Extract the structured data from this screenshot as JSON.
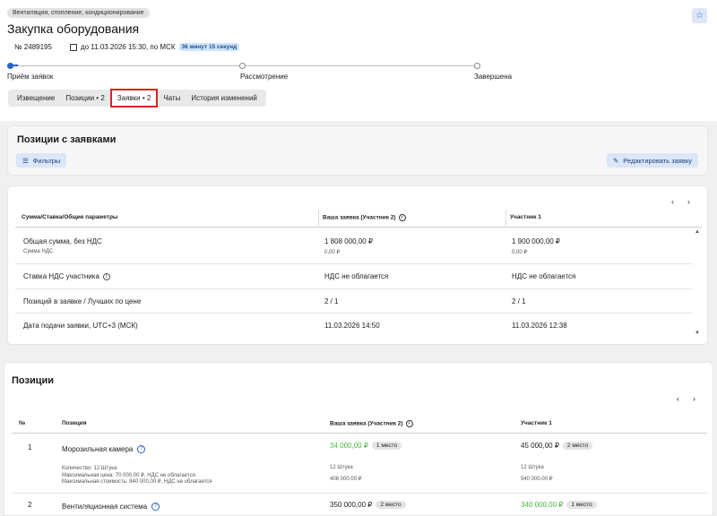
{
  "header": {
    "category": "Вентиляция, отопление, кондиционирование",
    "title": "Закупка оборудования",
    "number": "№ 2489195",
    "deadline": "до 11.03.2026 15:30, по МСК",
    "timer": "36 минут 15 секунд"
  },
  "stages": [
    {
      "label": "Приём заявок",
      "active": true
    },
    {
      "label": "Рассмотрение",
      "active": false
    },
    {
      "label": "Завершена",
      "active": false
    }
  ],
  "tabs": [
    {
      "label": "Извещение"
    },
    {
      "label": "Позиции • 2"
    },
    {
      "label": "Заявки • 2"
    },
    {
      "label": "Чаты"
    },
    {
      "label": "История изменений"
    }
  ],
  "bids_card": {
    "title": "Позиции с заявками",
    "filter_label": "Фильтры",
    "edit_label": "Редактировать заявку"
  },
  "summary_table": {
    "columns": [
      "Сумма/Ставка/Общие параметры",
      "Ваша заявка (Участник 2)",
      "Участник 1"
    ],
    "rows": [
      {
        "label": "Общая сумма, без НДС",
        "sub": "Сумма НДС",
        "v1": "1 808 000,00 ₽",
        "v1sub": "0,00 ₽",
        "v2": "1 900 000,00 ₽",
        "v2sub": "0,00 ₽"
      },
      {
        "label": "Ставка НДС участника",
        "v1": "НДС не облагается",
        "v2": "НДС не облагается"
      },
      {
        "label": "Позиций в заявке / Лучших по цене",
        "v1": "2 / 1",
        "v2": "2 / 1"
      },
      {
        "label": "Дата подачи заявки, UTC+3 (МСК)",
        "v1": "11.03.2026 14:50",
        "v2": "11.03.2026 12:38"
      }
    ]
  },
  "positions": {
    "title": "Позиции",
    "columns": [
      "№",
      "Позиция",
      "Ваша заявка (Участник 2)",
      "Участник 1"
    ],
    "rows": [
      {
        "num": "1",
        "name": "Морозильная камера",
        "details": [
          "Количество: 12 Штука",
          "Максимальная цена: 70 000,00 ₽, НДС не облагается",
          "Максимальная стоимость: 840 000,00 ₽, НДС не облагается"
        ],
        "p1": "34 000,00 ₽",
        "p1rank": "1 место",
        "p1qty": "12 Штука",
        "p1total": "408 000,00 ₽",
        "p2": "45 000,00 ₽",
        "p2rank": "2 место",
        "p2qty": "12 Штука",
        "p2total": "540 000,00 ₽"
      },
      {
        "num": "2",
        "name": "Вентиляционная система",
        "p1": "350 000,00 ₽",
        "p1rank": "2 место",
        "p2": "340 000,00 ₽",
        "p2rank": "1 место"
      }
    ]
  },
  "colors": {
    "accent": "#2563c9",
    "best": "#4bb543",
    "highlight": "#e02020"
  }
}
